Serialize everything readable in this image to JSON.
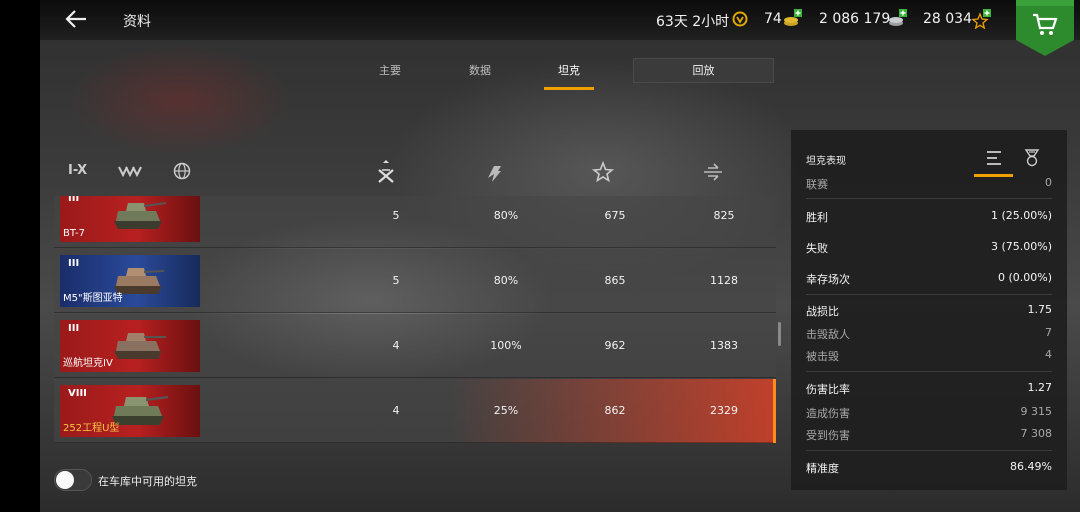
{
  "header": {
    "title": "资料",
    "premium_time": "63天 2小时",
    "gold": "74",
    "credits": "2 086 179",
    "free_xp": "28 034"
  },
  "tabs": [
    {
      "label": "主要"
    },
    {
      "label": "数据"
    },
    {
      "label": "坦克"
    },
    {
      "label": "回放"
    }
  ],
  "filters": {
    "tiers_label": "I-X"
  },
  "tanks": [
    {
      "tier": "III",
      "name": "BT-7",
      "battles": "5",
      "winrate": "80%",
      "avg_xp": "675",
      "avg_damage": "825"
    },
    {
      "tier": "III",
      "name": "M5\"斯图亚特",
      "battles": "5",
      "winrate": "80%",
      "avg_xp": "865",
      "avg_damage": "1128"
    },
    {
      "tier": "III",
      "name": "巡航坦克IV",
      "battles": "4",
      "winrate": "100%",
      "avg_xp": "962",
      "avg_damage": "1383"
    },
    {
      "tier": "VIII",
      "name": "252工程U型",
      "battles": "4",
      "winrate": "25%",
      "avg_xp": "862",
      "avg_damage": "2329"
    }
  ],
  "garage_toggle": {
    "label": "在车库中可用的坦克",
    "on": false
  },
  "panel": {
    "title": "坦克表现",
    "league": {
      "label": "联赛",
      "value": "0"
    },
    "wins": {
      "label": "胜利",
      "value": "1 (25.00%)"
    },
    "losses": {
      "label": "失败",
      "value": "3 (75.00%)"
    },
    "survived": {
      "label": "幸存场次",
      "value": "0 (0.00%)"
    },
    "kd": {
      "label": "战损比",
      "value": "1.75"
    },
    "kills": {
      "label": "击毁敌人",
      "value": "7"
    },
    "deaths": {
      "label": "被击毁",
      "value": "4"
    },
    "damage_ratio": {
      "label": "伤害比率",
      "value": "1.27"
    },
    "damage_dealt": {
      "label": "造成伤害",
      "value": "9 315"
    },
    "damage_received": {
      "label": "受到伤害",
      "value": "7 308"
    },
    "accuracy": {
      "label": "精准度",
      "value": "86.49%"
    }
  },
  "colors": {
    "accent": "#f0a000",
    "selected_row": "#d74128",
    "shop_green": "#2d8a2d"
  }
}
